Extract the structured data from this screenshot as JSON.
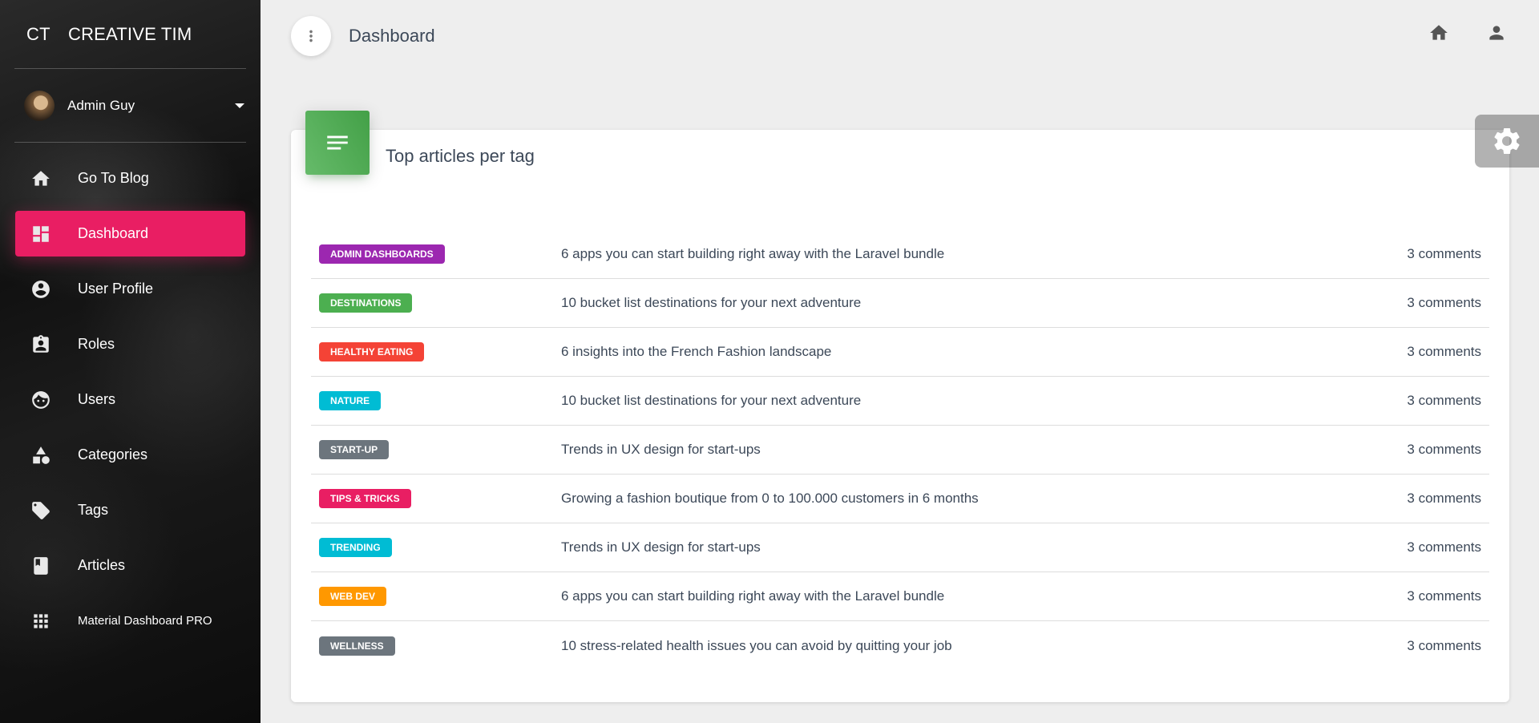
{
  "sidebar": {
    "logo_mini": "CT",
    "logo_text": "CREATIVE TIM",
    "user_name": "Admin Guy",
    "items": [
      {
        "label": "Go To Blog",
        "icon": "home-icon",
        "active": false
      },
      {
        "label": "Dashboard",
        "icon": "dashboard-icon",
        "active": true
      },
      {
        "label": "User Profile",
        "icon": "account-circle-icon",
        "active": false
      },
      {
        "label": "Roles",
        "icon": "assignment-ind-icon",
        "active": false
      },
      {
        "label": "Users",
        "icon": "face-icon",
        "active": false
      },
      {
        "label": "Categories",
        "icon": "category-icon",
        "active": false
      },
      {
        "label": "Tags",
        "icon": "tag-icon",
        "active": false
      },
      {
        "label": "Articles",
        "icon": "book-icon",
        "active": false
      },
      {
        "label": "Material Dashboard PRO",
        "icon": "apps-icon",
        "active": false
      }
    ],
    "active_color": "#e91e63"
  },
  "topbar": {
    "title": "Dashboard",
    "icons": [
      "home-icon",
      "person-icon"
    ]
  },
  "card": {
    "title": "Top articles per tag",
    "icon": "notes-icon",
    "icon_color": "#4caf50",
    "rows": [
      {
        "tag": "Admin Dashboards",
        "color": "#9c27b0",
        "title": "6 apps you can start building right away with the Laravel bundle",
        "comments": "3 comments"
      },
      {
        "tag": "Destinations",
        "color": "#4caf50",
        "title": "10 bucket list destinations for your next adventure",
        "comments": "3 comments"
      },
      {
        "tag": "Healthy Eating",
        "color": "#f44336",
        "title": "6 insights into the French Fashion landscape",
        "comments": "3 comments"
      },
      {
        "tag": "Nature",
        "color": "#00bcd4",
        "title": "10 bucket list destinations for your next adventure",
        "comments": "3 comments"
      },
      {
        "tag": "Start-up",
        "color": "#6c757d",
        "title": "Trends in UX design for start-ups",
        "comments": "3 comments"
      },
      {
        "tag": "Tips & Tricks",
        "color": "#e91e63",
        "title": "Growing a fashion boutique from 0 to 100.000 customers in 6 months",
        "comments": "3 comments"
      },
      {
        "tag": "Trending",
        "color": "#00bcd4",
        "title": "Trends in UX design for start-ups",
        "comments": "3 comments"
      },
      {
        "tag": "Web Dev",
        "color": "#ff9800",
        "title": "6 apps you can start building right away with the Laravel bundle",
        "comments": "3 comments"
      },
      {
        "tag": "Wellness",
        "color": "#6c757d",
        "title": "10 stress-related health issues you can avoid by quitting your job",
        "comments": "3 comments"
      }
    ]
  },
  "settings": {
    "icon": "gear-icon"
  }
}
